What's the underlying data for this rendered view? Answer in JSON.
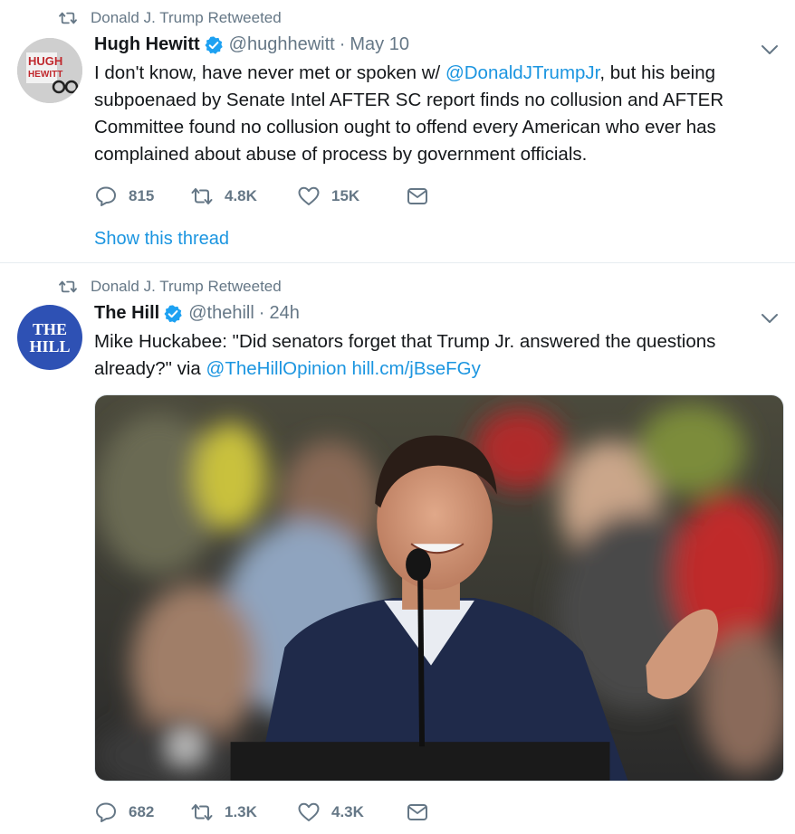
{
  "tweets": [
    {
      "retweet_label": "Donald J. Trump Retweeted",
      "author_name": "Hugh Hewitt",
      "handle": "@hughhewitt",
      "separator": "·",
      "time": "May 10",
      "text_pre": "I don't know, have never met or spoken w/ ",
      "mention": "@DonaldJTrumpJr",
      "text_post": ", but his being subpoenaed by Senate Intel AFTER SC report finds no collusion and AFTER Committee found no collusion ought to offend every American who ever has complained about abuse of process by government officials.",
      "replies": "815",
      "retweets": "4.8K",
      "likes": "15K",
      "show_thread": "Show this thread",
      "avatar_text_1": "HUGH",
      "avatar_text_2": "HEWITT"
    },
    {
      "retweet_label": "Donald J. Trump Retweeted",
      "author_name": "The Hill",
      "handle": "@thehill",
      "separator": "·",
      "time": "24h",
      "text_pre": "Mike Huckabee: \"Did senators forget that Trump Jr. answered the questions already?\" via ",
      "mention": "@TheHillOpinion",
      "link": "hill.cm/jBseFGy",
      "replies": "682",
      "retweets": "1.3K",
      "likes": "4.3K",
      "avatar_text_1": "THE",
      "avatar_text_2": "HILL"
    }
  ],
  "colors": {
    "link": "#1b95e0",
    "muted": "#657786",
    "verified": "#1da1f2",
    "hill_blue": "#2e51b4"
  },
  "icons": [
    "retweet-icon",
    "verified-badge-icon",
    "caret-down-icon",
    "reply-icon",
    "like-icon",
    "dm-icon"
  ]
}
